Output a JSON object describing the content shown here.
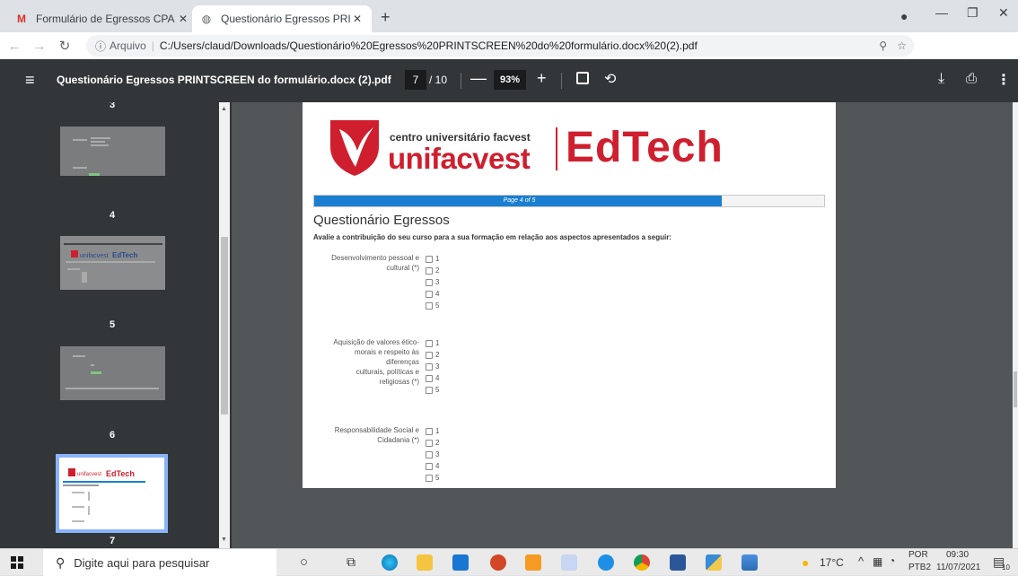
{
  "browser": {
    "tabs": [
      {
        "title": "Formulário de Egressos CPA unifa",
        "favicon": "gmail-icon",
        "active": false
      },
      {
        "title": "Questionário Egressos PRINTSCR",
        "favicon": "globe-icon",
        "active": true
      }
    ],
    "new_tab": "+",
    "address": {
      "info": "ⓘ",
      "scheme": "Arquivo",
      "separator": "|",
      "url": "C:/Users/claud/Downloads/Questionário%20Egressos%20PRINTSCREEN%20do%20formulário.docx%20(2).pdf"
    }
  },
  "pdf_toolbar": {
    "title": "Questionário Egressos PRINTSCREEN do formulário.docx (2).pdf",
    "current_page": "7",
    "total_pages": "/ 10",
    "zoom": "93%",
    "zoom_out": "—",
    "zoom_in": "+"
  },
  "thumbnails": [
    {
      "number": "3"
    },
    {
      "number": "4"
    },
    {
      "number": "5"
    },
    {
      "number": "6"
    },
    {
      "number": "7"
    }
  ],
  "document": {
    "logo_small": "centro universitário facvest",
    "logo_big": "unifacvest",
    "logo_brand": "EdTech",
    "progress_label": "Page 4 of 5",
    "progress_fraction": 0.8,
    "title": "Questionário Egressos",
    "intro": "Avalie a contribuição do seu curso para a sua formação em relação aos aspectos apresentados a seguir:",
    "questions": [
      {
        "label_lines": [
          "Desenvolvimento pessoal e",
          "cultural (*)"
        ],
        "options": [
          "1",
          "2",
          "3",
          "4",
          "5"
        ]
      },
      {
        "label_lines": [
          "Aquisição de valores ético-",
          "morais e respeito às diferenças",
          "culturais, políticas e",
          "religiosas (*)"
        ],
        "options": [
          "1",
          "2",
          "3",
          "4",
          "5"
        ]
      },
      {
        "label_lines": [
          "Responsabilidade Social e",
          "Cidadania (*)"
        ],
        "options": [
          "1",
          "2",
          "3",
          "4",
          "5"
        ]
      }
    ]
  },
  "taskbar": {
    "search_placeholder": "Digite aqui para pesquisar",
    "weather": "17°C",
    "lang_top": "POR",
    "lang_bottom": "PTB2",
    "time": "09:30",
    "date": "11/07/2021",
    "notifications": "10"
  }
}
